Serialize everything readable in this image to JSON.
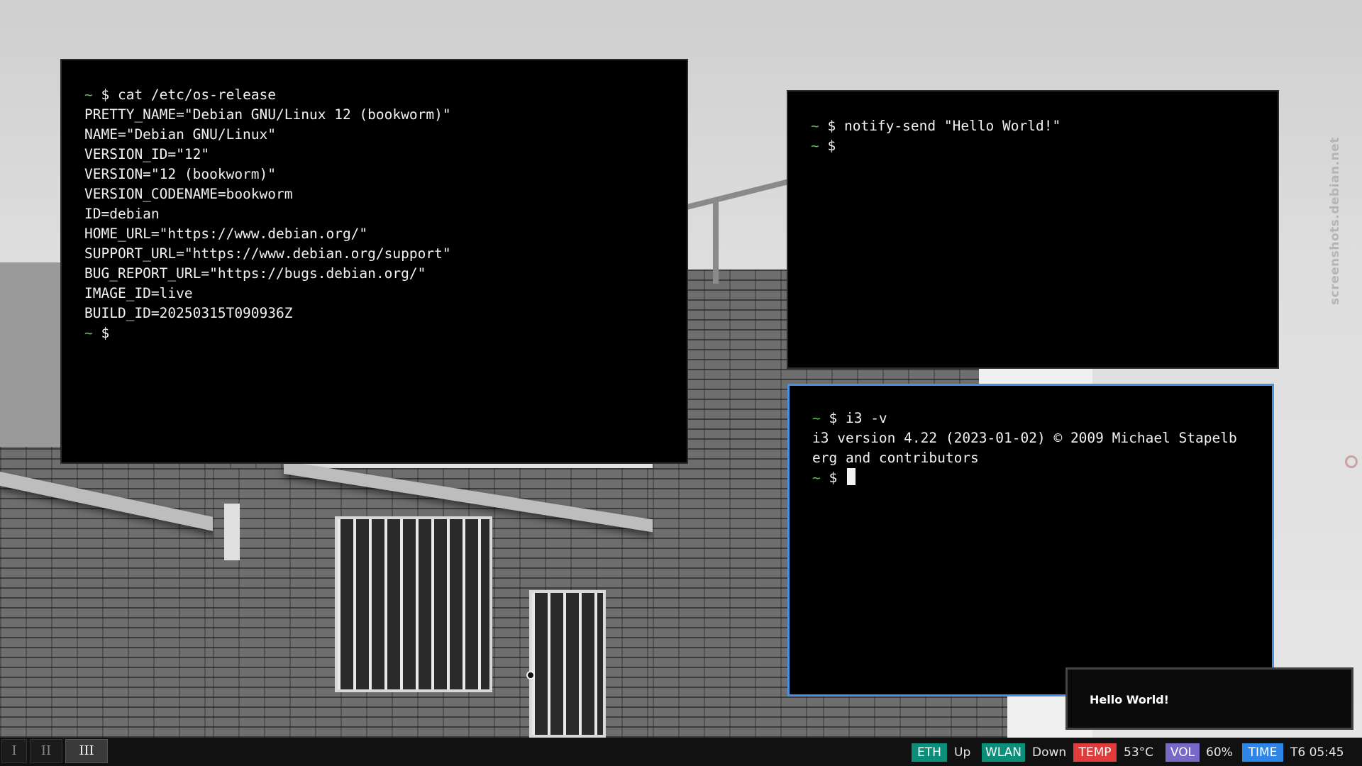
{
  "watermark": "screenshots.debian.net",
  "windows": {
    "os_release": {
      "lines": [
        {
          "prompt": "~ $",
          "text": " cat /etc/os-release"
        },
        {
          "prompt": "",
          "text": "PRETTY_NAME=\"Debian GNU/Linux 12 (bookworm)\""
        },
        {
          "prompt": "",
          "text": "NAME=\"Debian GNU/Linux\""
        },
        {
          "prompt": "",
          "text": "VERSION_ID=\"12\""
        },
        {
          "prompt": "",
          "text": "VERSION=\"12 (bookworm)\""
        },
        {
          "prompt": "",
          "text": "VERSION_CODENAME=bookworm"
        },
        {
          "prompt": "",
          "text": "ID=debian"
        },
        {
          "prompt": "",
          "text": "HOME_URL=\"https://www.debian.org/\""
        },
        {
          "prompt": "",
          "text": "SUPPORT_URL=\"https://www.debian.org/support\""
        },
        {
          "prompt": "",
          "text": "BUG_REPORT_URL=\"https://bugs.debian.org/\""
        },
        {
          "prompt": "",
          "text": "IMAGE_ID=live"
        },
        {
          "prompt": "",
          "text": "BUILD_ID=20250315T090936Z"
        },
        {
          "prompt": "~ $",
          "text": ""
        }
      ]
    },
    "notify": {
      "lines": [
        {
          "prompt": "~ $",
          "text": " notify-send \"Hello World!\""
        },
        {
          "prompt": "~ $",
          "text": ""
        }
      ]
    },
    "i3": {
      "lines": [
        {
          "prompt": "~ $",
          "text": " i3 -v"
        },
        {
          "prompt": "",
          "text": "i3 version 4.22 (2023-01-02) © 2009 Michael Stapelb"
        },
        {
          "prompt": "",
          "text": "erg and contributors"
        },
        {
          "prompt": "~ $",
          "text": " "
        }
      ]
    }
  },
  "notification": {
    "text": "Hello World!"
  },
  "bar": {
    "workspaces": [
      {
        "label": "I",
        "active": false
      },
      {
        "label": "II",
        "active": false
      },
      {
        "label": "III",
        "active": true
      }
    ],
    "status": [
      {
        "label": "ETH",
        "value": "Up",
        "color": "#0b8f7a"
      },
      {
        "label": "WLAN",
        "value": "Down",
        "color": "#0b8f7a"
      },
      {
        "label": "TEMP",
        "value": "53°C",
        "color": "#e03c3c"
      },
      {
        "label": "VOL",
        "value": "60%",
        "color": "#7a68c8"
      },
      {
        "label": "TIME",
        "value": "T6 05:45",
        "color": "#2f86e8"
      }
    ]
  },
  "icons": {
    "pointer": "busy-cursor-icon",
    "watermark_logo": "debian-swirl-icon"
  }
}
